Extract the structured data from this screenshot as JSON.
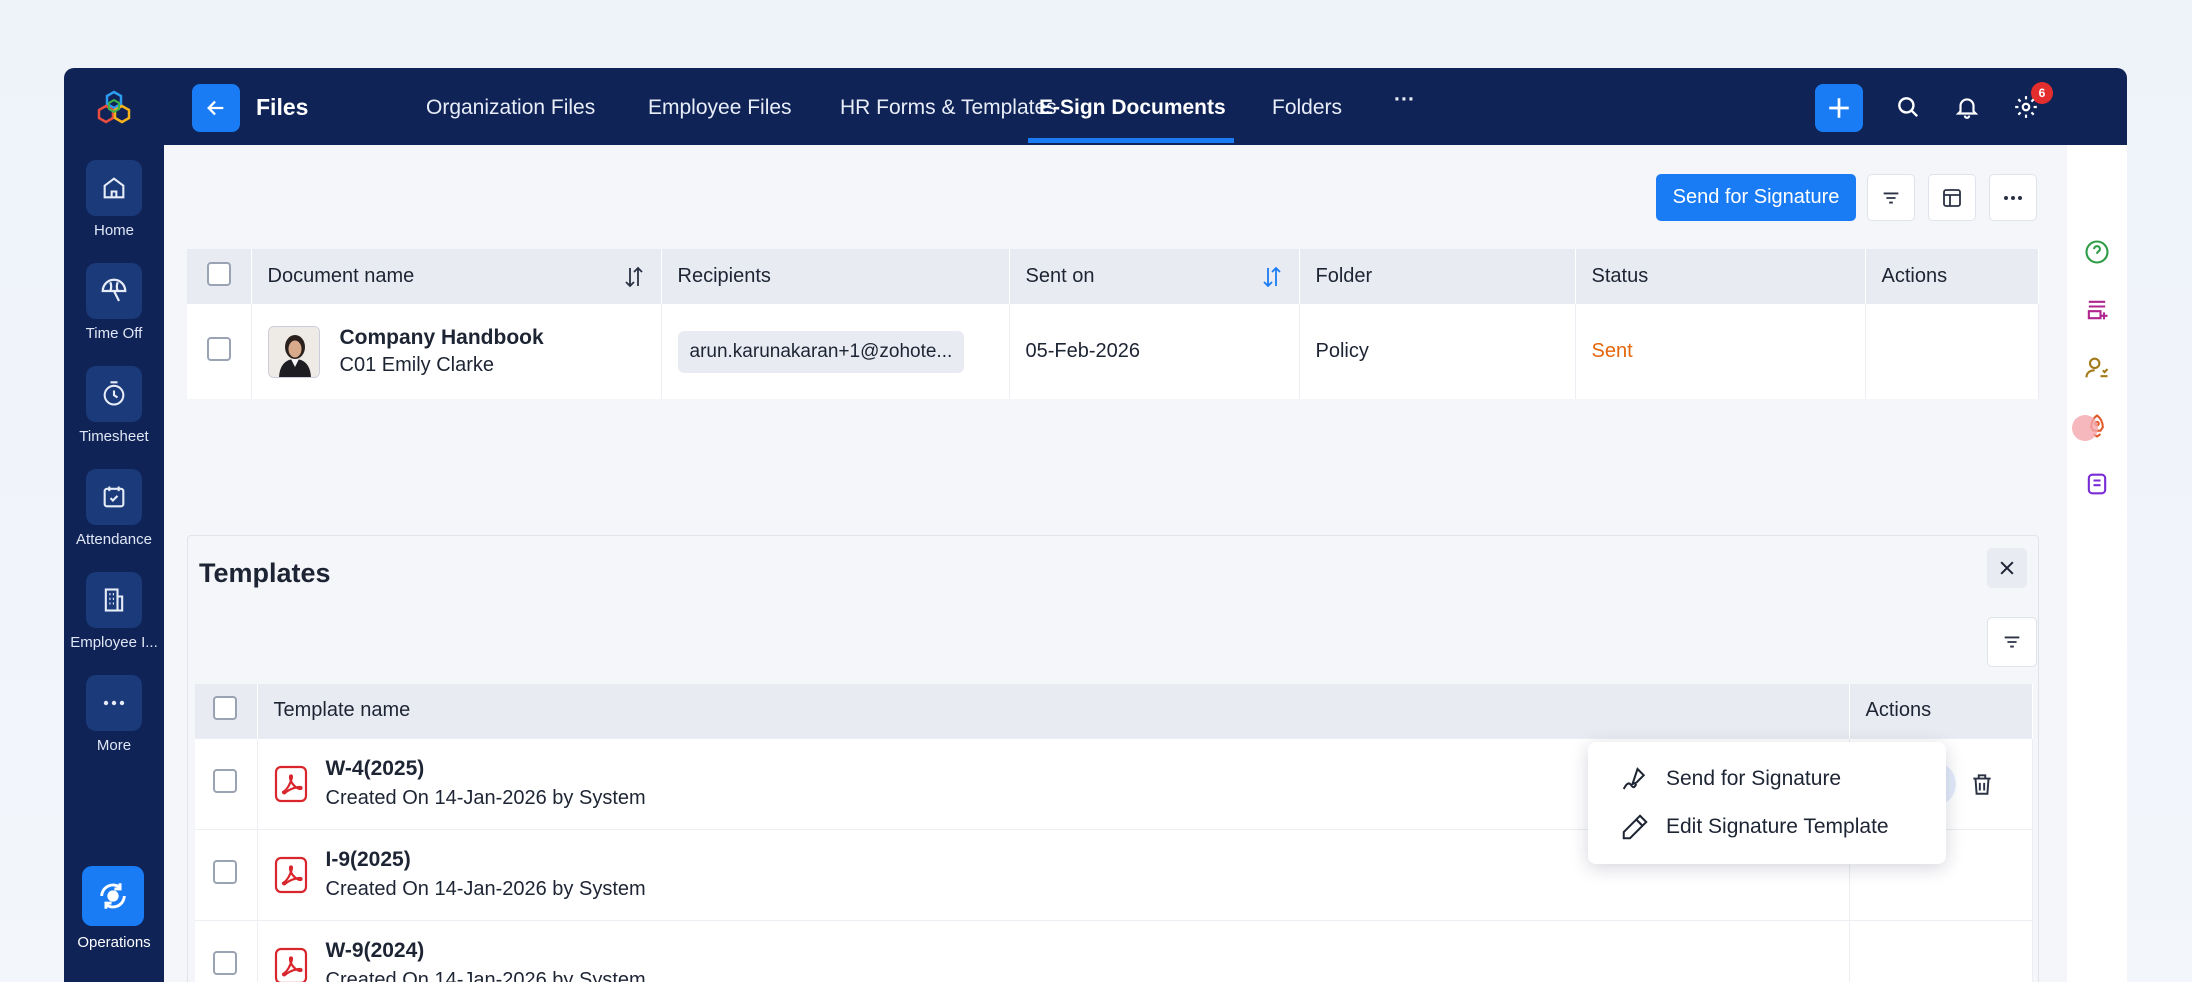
{
  "rail": {
    "items": [
      {
        "label": "Home",
        "icon": "home-icon"
      },
      {
        "label": "Time Off",
        "icon": "umbrella-icon"
      },
      {
        "label": "Timesheet",
        "icon": "timer-icon"
      },
      {
        "label": "Attendance",
        "icon": "calendar-check-icon"
      },
      {
        "label": "Employee I...",
        "icon": "building-icon"
      },
      {
        "label": "More",
        "icon": "more-dots-icon"
      }
    ],
    "operations_label": "Operations"
  },
  "topbar": {
    "title": "Files",
    "tabs": [
      {
        "label": "Organization Files"
      },
      {
        "label": "Employee Files"
      },
      {
        "label": "HR Forms & Templates"
      },
      {
        "label": "E-Sign Documents"
      },
      {
        "label": "Folders"
      }
    ],
    "more_tabs": "···",
    "notification_count": "6"
  },
  "toolbar": {
    "send_label": "Send for Signature"
  },
  "documents": {
    "columns": [
      "Document name",
      "Recipients",
      "Sent on",
      "Folder",
      "Status",
      "Actions"
    ],
    "rows": [
      {
        "title": "Company Handbook",
        "employee": "C01 Emily Clarke",
        "recipient": "arun.karunakaran+1@zohote...",
        "sent_on": "05-Feb-2026",
        "folder": "Policy",
        "status": "Sent"
      }
    ]
  },
  "templates": {
    "title": "Templates",
    "columns": [
      "Template name",
      "Actions"
    ],
    "rows": [
      {
        "name": "W-4(2025)",
        "created": "Created On 14-Jan-2026 by System"
      },
      {
        "name": "I-9(2025)",
        "created": "Created On 14-Jan-2026 by System"
      },
      {
        "name": "W-9(2024)",
        "created": "Created On 14-Jan-2026 by System"
      }
    ]
  },
  "context_menu": {
    "items": [
      {
        "label": "Send for Signature",
        "icon": "signature-icon"
      },
      {
        "label": "Edit Signature Template",
        "icon": "pencil-icon"
      }
    ]
  },
  "colors": {
    "navy": "#0f2356",
    "accent": "#1a7cf5",
    "status_sent": "#e5650b",
    "pdf_red": "#d9262c"
  }
}
